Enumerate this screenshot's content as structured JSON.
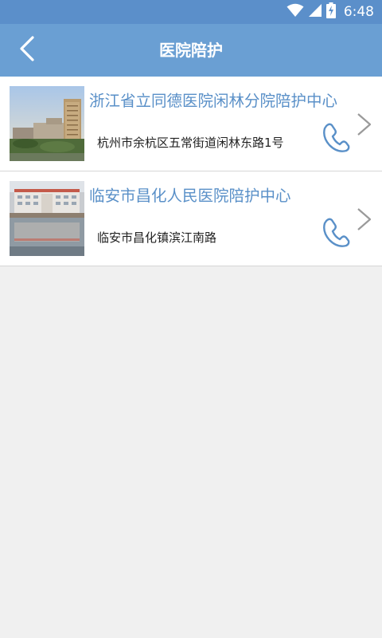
{
  "status_bar": {
    "time": "6:48",
    "icons": [
      "wifi-icon",
      "cell-signal-icon",
      "battery-charging-icon"
    ]
  },
  "app_bar": {
    "title": "医院陪护",
    "back_icon": "back-arrow-icon"
  },
  "colors": {
    "status_bar": "#5b8fca",
    "app_bar": "#6a9fd3",
    "title_text": "#5a90c8",
    "icon_blue": "#5a90c8",
    "background": "#f0f0f0"
  },
  "hospitals": [
    {
      "name": "浙江省立同德医院闲林分院陪护中心",
      "address": "杭州市余杭区五常街道闲林东路1号",
      "phone_icon": "phone-icon",
      "chevron_icon": "chevron-right-icon"
    },
    {
      "name": "临安市昌化人民医院陪护中心",
      "address": "临安市昌化镇滨江南路",
      "phone_icon": "phone-icon",
      "chevron_icon": "chevron-right-icon"
    }
  ]
}
